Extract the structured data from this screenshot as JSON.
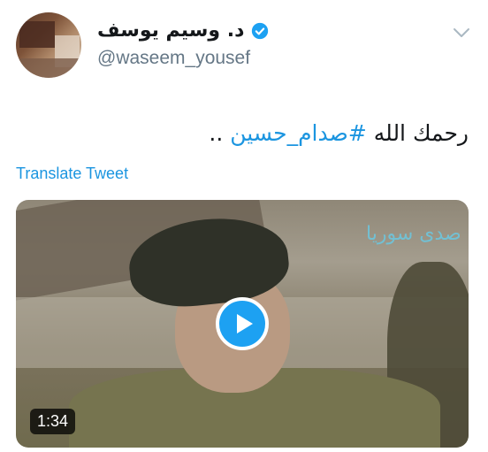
{
  "author": {
    "display_name": "د. وسيم يوسف",
    "handle": "@waseem_yousef",
    "verified": true
  },
  "tweet": {
    "text_prefix": "رحمك الله ",
    "hashtag": "#صدام_حسين",
    "text_suffix": " ..",
    "translate_label": "Translate Tweet"
  },
  "media": {
    "type": "video",
    "duration": "1:34",
    "watermark": "صدى سوريا"
  },
  "colors": {
    "link": "#1b95e0",
    "verified_badge": "#1da1f2",
    "secondary_text": "#657786"
  },
  "icons": {
    "verified": "verified-badge-icon",
    "caret": "chevron-down-icon",
    "play": "play-icon"
  }
}
